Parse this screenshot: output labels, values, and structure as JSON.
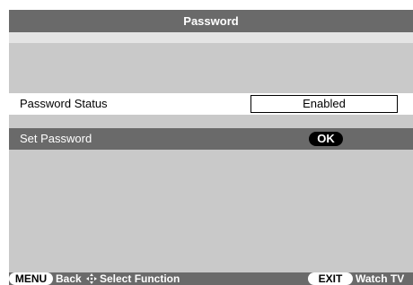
{
  "title": "Password",
  "rows": {
    "password_status": {
      "label": "Password Status",
      "value": "Enabled"
    },
    "set_password": {
      "label": "Set Password",
      "button": "OK"
    }
  },
  "footer": {
    "menu_key": "MENU",
    "back_label": "Back",
    "navigate_icon": "four-way-arrow-icon",
    "select_label": "Select Function",
    "exit_key": "EXIT",
    "watch_label": "Watch TV"
  },
  "colors": {
    "panel_background": "#c9c9c9",
    "title_bar": "#6a6a6a",
    "highlight_row": "#ffffff",
    "selected_row": "#6a6a6a"
  }
}
